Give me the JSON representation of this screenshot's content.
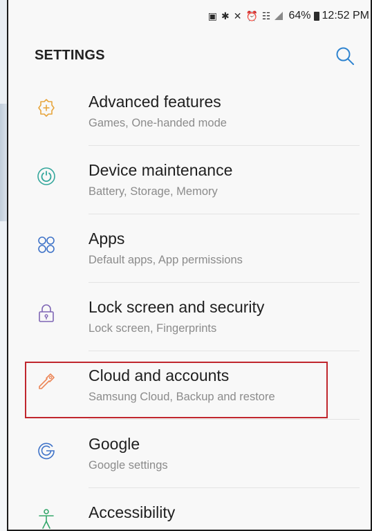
{
  "status_bar": {
    "battery": "64%",
    "time": "12:52 PM",
    "icons": [
      "screenshot-icon",
      "bluetooth-icon",
      "mute-icon",
      "alarm-icon",
      "wifi-icon",
      "signal-icon",
      "battery-icon"
    ]
  },
  "header": {
    "title": "SETTINGS",
    "search_icon": "search-icon"
  },
  "settings_items": [
    {
      "label": "Advanced features",
      "sub": "Games, One-handed mode",
      "icon": "gear-plus-icon",
      "icon_color": "#e7a53c"
    },
    {
      "label": "Device maintenance",
      "sub": "Battery, Storage, Memory",
      "icon": "maintenance-icon",
      "icon_color": "#35a79c"
    },
    {
      "label": "Apps",
      "sub": "Default apps, App permissions",
      "icon": "apps-icon",
      "icon_color": "#3f73c8"
    },
    {
      "label": "Lock screen and security",
      "sub": "Lock screen, Fingerprints",
      "icon": "lock-icon",
      "icon_color": "#7f66b5"
    },
    {
      "label": "Cloud and accounts",
      "sub": "Samsung Cloud, Backup and restore",
      "icon": "key-icon",
      "icon_color": "#ec8759"
    },
    {
      "label": "Google",
      "sub": "Google settings",
      "icon": "google-icon",
      "icon_color": "#3f73c8"
    },
    {
      "label": "Accessibility",
      "sub": "",
      "icon": "accessibility-icon",
      "icon_color": "#34a76b"
    }
  ],
  "annotation": {
    "color": "#c0262d"
  }
}
